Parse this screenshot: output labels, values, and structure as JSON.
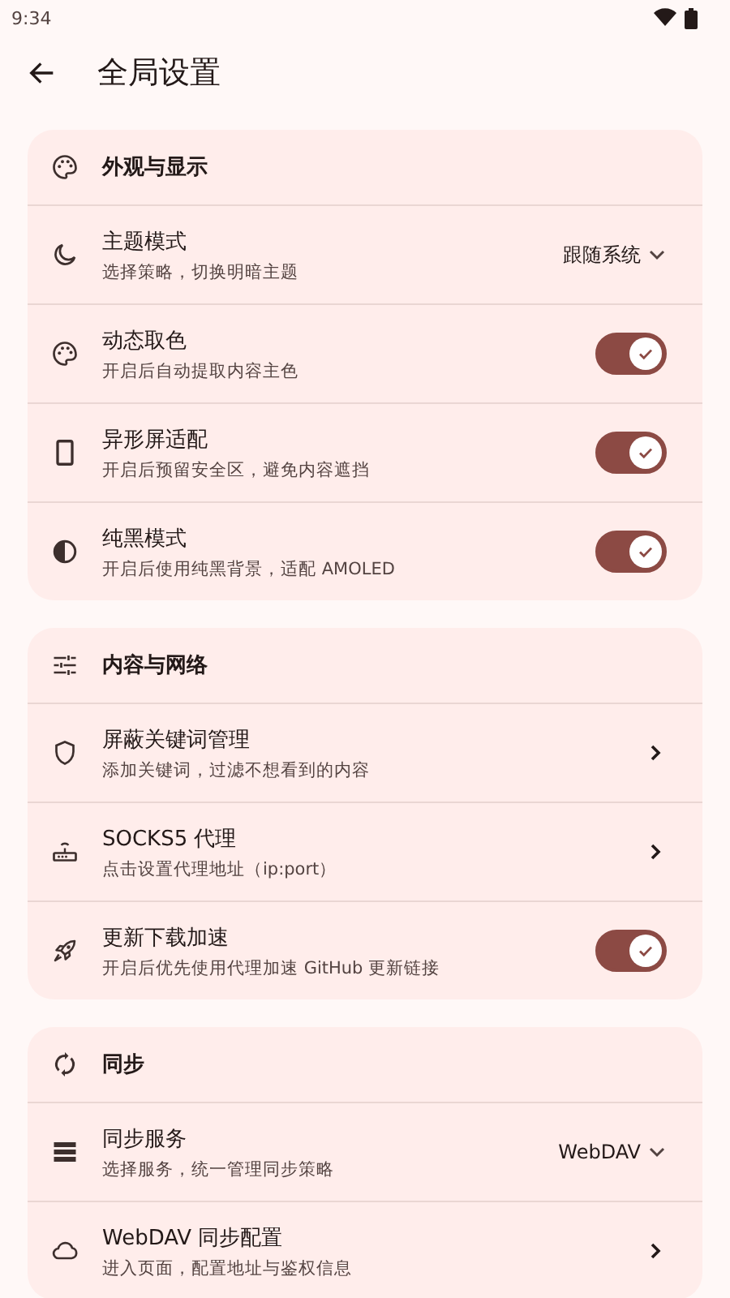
{
  "status_bar": {
    "time": "9:34"
  },
  "app_bar": {
    "title": "全局设置"
  },
  "sections": [
    {
      "title": "外观与显示",
      "items": [
        {
          "kind": "dropdown",
          "title": "主题模式",
          "subtitle": "选择策略，切换明暗主题",
          "value": "跟随系统"
        },
        {
          "kind": "toggle",
          "title": "动态取色",
          "subtitle": "开启后自动提取内容主色",
          "on": true
        },
        {
          "kind": "toggle",
          "title": "异形屏适配",
          "subtitle": "开启后预留安全区，避免内容遮挡",
          "on": true
        },
        {
          "kind": "toggle",
          "title": "纯黑模式",
          "subtitle": "开启后使用纯黑背景，适配 AMOLED",
          "on": true
        }
      ]
    },
    {
      "title": "内容与网络",
      "items": [
        {
          "kind": "link",
          "title": "屏蔽关键词管理",
          "subtitle": "添加关键词，过滤不想看到的内容"
        },
        {
          "kind": "link",
          "title": "SOCKS5 代理",
          "subtitle": "点击设置代理地址（ip:port）"
        },
        {
          "kind": "toggle",
          "title": "更新下载加速",
          "subtitle": "开启后优先使用代理加速 GitHub 更新链接",
          "on": true
        }
      ]
    },
    {
      "title": "同步",
      "items": [
        {
          "kind": "dropdown",
          "title": "同步服务",
          "subtitle": "选择服务，统一管理同步策略",
          "value": "WebDAV"
        },
        {
          "kind": "link",
          "title": "WebDAV 同步配置",
          "subtitle": "进入页面，配置地址与鉴权信息"
        }
      ]
    }
  ]
}
